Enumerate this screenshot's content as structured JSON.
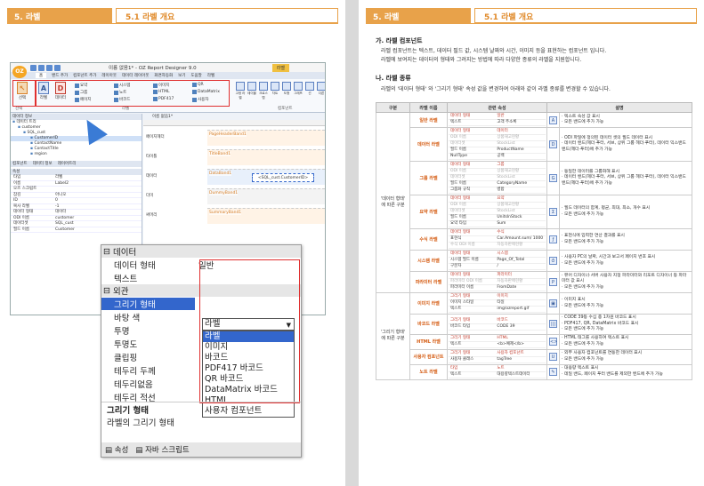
{
  "header": {
    "chapter": "5. 라벨",
    "section": "5.1 라벨 개요"
  },
  "designer": {
    "title": "이름 없음1* - OZ Report Designer 9.0",
    "context_tab": "라벨",
    "logo": "OZ",
    "tabs": [
      "홈",
      "밴드 추가",
      "컴포넌트 추가",
      "레이아웃",
      "데이터 레이아웃",
      "화면자동화",
      "보기",
      "도움말",
      "라벨"
    ],
    "ribbon": {
      "big": [
        "선택",
        "라벨",
        "데이터"
      ],
      "small": [
        "요약",
        "그룹",
        "페이지",
        "시스템",
        "노트",
        "바코드",
        "이미지",
        "HTML",
        "PDF417",
        "QR",
        "DataMatrix",
        "사용자"
      ],
      "right": [
        "고정 라벨",
        "테이블",
        "크로스탭",
        "차트",
        "도형",
        "그래프",
        "선",
        "다른"
      ],
      "group_labels": [
        "선택",
        "라벨",
        "컴포넌트"
      ]
    },
    "left_panel": {
      "title": "데이터 정보",
      "tree": [
        "데이터 트리",
        "customer",
        "SQL_cust",
        "CustomerID",
        "ContactName",
        "ContactTitle",
        "region"
      ],
      "tabs": [
        "컴포넌트",
        "데이터 정보",
        "레이어트리"
      ],
      "props_title": "속성",
      "props": [
        {
          "k": "타입",
          "v": "라벨"
        },
        {
          "k": "이름",
          "v": "Label2"
        },
        {
          "k": "오즈 스크립트",
          "v": ""
        },
        {
          "k": "잠김",
          "v": "아니오"
        },
        {
          "k": "ID",
          "v": "0"
        },
        {
          "k": "복사 라벨",
          "v": "-1"
        },
        {
          "k": "데이터 형태",
          "v": "데이터"
        },
        {
          "k": "ODI 이름",
          "v": "customer"
        },
        {
          "k": "데이터셋",
          "v": "SQL_cust"
        },
        {
          "k": "필드 이름",
          "v": "Customer"
        }
      ]
    },
    "canvas": {
      "tab": "이름 없음1*",
      "bands": [
        {
          "label": "페이지헤더",
          "band": "PageHeaderBand1"
        },
        {
          "label": "타이틀",
          "band": "TitleBand1"
        },
        {
          "label": "데이터",
          "band": "DataBand1",
          "field": "<SQL_cust.CustomerID>"
        },
        {
          "label": "더미",
          "band": "DummyBand1"
        },
        {
          "label": "써머리",
          "band": "SummaryBand1"
        }
      ]
    }
  },
  "zoom_panel": {
    "cat_data": "데이터",
    "row_data_type": {
      "k": "데이터 형태",
      "v": "일반"
    },
    "row_text": {
      "k": "텍스트",
      "v": ""
    },
    "cat_look": "외관",
    "row_draw": {
      "k": "그리기 형태",
      "v": "라벨"
    },
    "rows_rest": [
      "바탕 색",
      "투명",
      "투명도",
      "클립핑",
      "테두리 두께",
      "테두리없음",
      "테두리 적선"
    ],
    "dropdown": [
      "라벨",
      "이미지",
      "바코드",
      "PDF417 바코드",
      "QR 바코드",
      "DataMatrix 바코드",
      "HTML",
      "사용자 컴포넌트"
    ],
    "desc_title": "그리기 형태",
    "desc_text": "라벨의 그리기 형태",
    "footer": [
      "속성",
      "자바 스크립트"
    ]
  },
  "right": {
    "h_a": "가. 라벨 컴포넌트",
    "p_a1": "라벨 컴포넌트는 텍스트, 데이터 필드 값, 시스템 날짜와 시간, 이미지 등을 표현하는 컴포넌트 입니다.",
    "p_a2": "라벨에 보여지는 데이터의 형태와 그려지는 방법에 따라 다양한 종류의 라벨을 지원합니다.",
    "h_b": "나. 라벨 종류",
    "p_b": "라벨의 '데이터 형태' 와 '그리기 형태' 속성 값을 변경하여 아래와 같이 라벨 종류를 변경할 수 있습니다.",
    "table_headers": [
      "구분",
      "라벨 이름",
      "관련 속성",
      "설명"
    ],
    "groups": [
      "'데이터 형태' 에 따른 구분",
      "'그리기 형태' 에 따른 구분"
    ],
    "rows": [
      {
        "name": "일반 라벨",
        "props": [
          [
            "데이터 형태",
            "일반",
            "r"
          ],
          [
            "텍스트",
            "고객 주소록",
            ""
          ]
        ],
        "desc": "· 텍스트 속성 값 표시\n· 모든 밴드에 추가 가능"
      },
      {
        "name": "데이터 라벨",
        "props": [
          [
            "데이터 형태",
            "데이터",
            "r"
          ],
          [
            "ODI 이름",
            "상품재고현황",
            "g"
          ],
          [
            "데이터셋",
            "StockList",
            "g"
          ],
          [
            "필드 이름",
            "ProductName",
            ""
          ],
          [
            "NullType",
            "공백",
            ""
          ]
        ],
        "desc": "· ODI 파일에 정의된 데이터 셋의 필드 데이터 표시\n· 데이터 밴드(헤더·푸터, 서브, 상위 그룹 헤더·푸터), 데이터 익스밴드 밴드(헤더·푸터)에 추가 가능"
      },
      {
        "name": "그룹 라벨",
        "props": [
          [
            "데이터 형태",
            "그룹",
            "r"
          ],
          [
            "ODI 이름",
            "상품재고현황",
            "g"
          ],
          [
            "데이터셋",
            "StockList",
            "g"
          ],
          [
            "필드 이름",
            "CategoryName",
            ""
          ],
          [
            "그룹화 규칙",
            "병합",
            ""
          ]
        ],
        "desc": "· 동일한 데이터를 그룹화해 표시\n· 데이터 밴드(헤더·푸터, 서브, 상위 그룹 헤더·푸터), 데이터 익스밴드 밴드(헤더·푸터)에 추가 가능"
      },
      {
        "name": "요약 라벨",
        "props": [
          [
            "데이터 형태",
            "요약",
            "r"
          ],
          [
            "ODI 이름",
            "상품재고현황",
            "g"
          ],
          [
            "데이터셋",
            "StockList",
            "g"
          ],
          [
            "필드 이름",
            "UnitsInStock",
            ""
          ],
          [
            "요약 타입",
            "Sum",
            ""
          ]
        ],
        "desc": "· 필드 데이터의 합계, 평균, 최대, 최소, 개수 표시\n· 모든 밴드에 추가 가능"
      },
      {
        "name": "수식 라벨",
        "props": [
          [
            "데이터 형태",
            "수식",
            "r"
          ],
          [
            "표현식",
            "Car.Amount.sum/ 1000",
            ""
          ],
          [
            "수식 ODI 이름",
            "자동차판매현황",
            "g"
          ]
        ],
        "desc": "· 표현식에 입력한 연산 결과를 표시\n· 모든 밴드에 추가 가능"
      },
      {
        "name": "시스템 라벨",
        "props": [
          [
            "데이터 형태",
            "시스템",
            "r"
          ],
          [
            "시스템 필드 이름",
            "Page_Of_Total",
            ""
          ],
          [
            "구분자",
            "/",
            ""
          ]
        ],
        "desc": "· 사용자 PC의 날짜, 시간과 보고서 페이지 번호 표시\n· 모든 밴드에 추가 가능"
      },
      {
        "name": "파라미터 라벨",
        "props": [
          [
            "데이터 형태",
            "파라미터",
            "r"
          ],
          [
            "파라미터 ODI 이름",
            "자동차판매현황",
            "g"
          ],
          [
            "파라미터 이름",
            "FromDate",
            ""
          ]
        ],
        "desc": "· 뷰어 디자이너·서버 사용자 지정 파라미터와 리포트 디자이너 등 파라미터 값 표시\n· 모든 밴드에 추가 가능"
      },
      {
        "name": "이미지 라벨",
        "props": [
          [
            "그리기 형태",
            "이미지",
            "r"
          ],
          [
            "이미지 스타일",
            "타일",
            ""
          ],
          [
            "텍스트",
            "img/ozreport.gif",
            ""
          ]
        ],
        "desc": "· 이미지 표시\n· 모든 밴드에 추가 가능"
      },
      {
        "name": "바코드 라벨",
        "props": [
          [
            "그리기 형태",
            "바코드",
            "r"
          ],
          [
            "바코드 타입",
            "CODE 39",
            ""
          ]
        ],
        "desc": "· CODE 39등 수십 종 1차원 바코드 표시\n· PDF417, QR, DataMatrix 바코드 표시\n· 모든 밴드에 추가 가능"
      },
      {
        "name": "HTML 라벨",
        "props": [
          [
            "그리기 형태",
            "HTML",
            "r"
          ],
          [
            "텍스트",
            "<b>예제</b>",
            ""
          ]
        ],
        "desc": "· HTML 태그를 사용하여 텍스트 표시\n· 모든 밴드에 추가 가능"
      },
      {
        "name": "사용자 컴포넌트",
        "props": [
          [
            "그리기 형태",
            "사용자 컴포넌트",
            "r"
          ],
          [
            "사용자 클래스",
            "tagTree",
            ""
          ]
        ],
        "desc": "· 외부 사용자 컴포넌트를 연동한 데이터 표시\n· 모든 밴드에 추가 가능"
      },
      {
        "name": "노트 라벨",
        "props": [
          [
            "타입",
            "노트",
            "r"
          ],
          [
            "텍스트",
            "대용량텍스트데이터",
            ""
          ]
        ],
        "desc": "· 대용량 텍스트 표시\n· 데일 밴드, 페이지 푸터 밴드를 제외한 밴드에 추가 가능"
      }
    ]
  }
}
